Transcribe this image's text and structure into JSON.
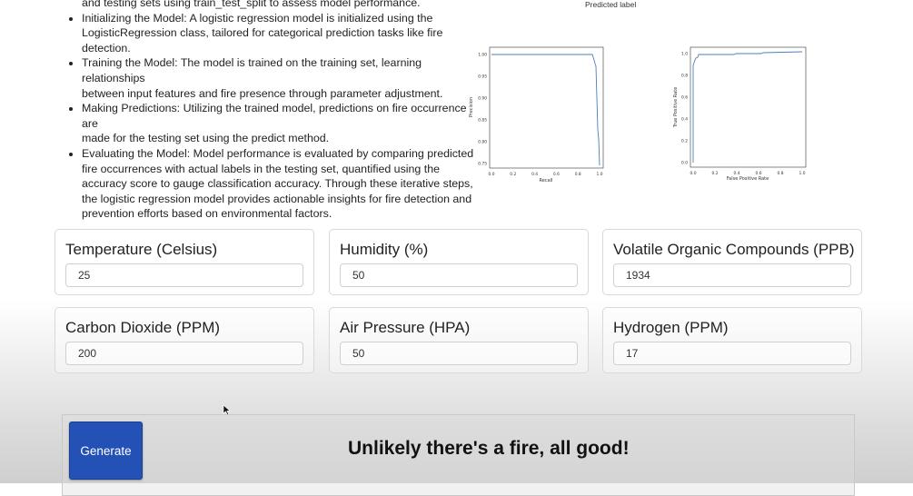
{
  "description": {
    "partial_line": "and testing sets using train_test_split to assess model performance.",
    "bullets": [
      {
        "lines": [
          "Initializing the Model: A logistic regression model is initialized using the",
          "LogisticRegression class, tailored for categorical prediction tasks like fire",
          "detection."
        ]
      },
      {
        "lines": [
          "Training the Model: The model is trained on the training set, learning relationships",
          "between input features and fire presence through parameter adjustment."
        ]
      },
      {
        "lines": [
          "Making Predictions: Utilizing the trained model, predictions on fire occurrence are",
          "made for the testing set using the predict method."
        ]
      },
      {
        "lines": [
          "Evaluating the Model: Model performance is evaluated by comparing predicted",
          "fire occurrences with actual labels in the testing set, quantified using the",
          "accuracy score to gauge classification accuracy. Through these iterative steps,",
          "the logistic regression model provides actionable insights for fire detection and",
          "prevention efforts based on environmental factors."
        ]
      }
    ]
  },
  "plots": {
    "top_label": "Predicted label",
    "pr": {
      "xlabel": "Recall",
      "ylabel": "Precision",
      "xticks": [
        "0.0",
        "0.2",
        "0.4",
        "0.6",
        "0.8",
        "1.0"
      ],
      "yticks": [
        "1.00",
        "0.95",
        "0.90",
        "0.85",
        "0.80",
        "0.75"
      ],
      "color": "#4c7fb8"
    },
    "roc": {
      "xlabel": "False Positive Rate",
      "ylabel": "True Positive Rate",
      "xticks": [
        "0.0",
        "0.2",
        "0.4",
        "0.6",
        "0.8",
        "1.0"
      ],
      "yticks": [
        "1.0",
        "0.8",
        "0.6",
        "0.4",
        "0.2",
        "0.0"
      ],
      "color": "#4c7fb8"
    }
  },
  "inputs": [
    {
      "label": "Temperature (Celsius)",
      "value": "25"
    },
    {
      "label": "Humidity (%)",
      "value": "50"
    },
    {
      "label": "Volatile Organic Compounds (PPB)",
      "value": "1934"
    },
    {
      "label": "Carbon Dioxide (PPM)",
      "value": "200"
    },
    {
      "label": "Air Pressure (HPA)",
      "value": "50"
    },
    {
      "label": "Hydrogen (PPM)",
      "value": "17"
    }
  ],
  "action": {
    "button_label": "Generate",
    "result_text": "Unlikely there's a fire, all good!",
    "button_color": "#2451b5"
  }
}
